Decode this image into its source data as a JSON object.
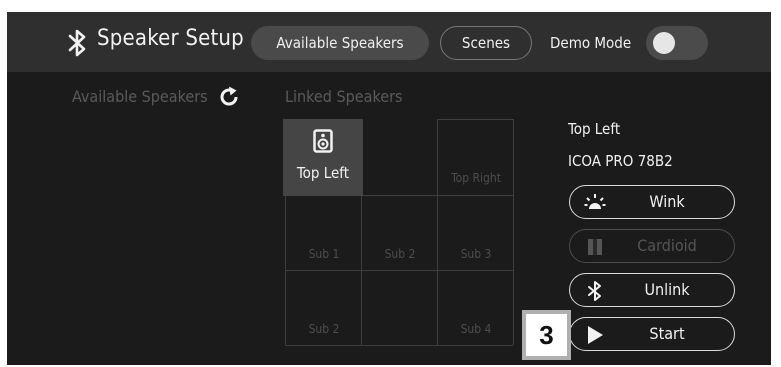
{
  "header": {
    "title": "Speaker Setup",
    "tabs": [
      {
        "label": "Available Speakers",
        "active": true
      },
      {
        "label": "Scenes",
        "active": false
      }
    ],
    "demo_mode": {
      "label": "Demo Mode",
      "enabled": false
    }
  },
  "panels": {
    "available_label": "Available Speakers",
    "linked_label": "Linked Speakers"
  },
  "grid": {
    "top_left": "Top Left",
    "top_right": "Top Right",
    "sub1": "Sub 1",
    "sub2_mid": "Sub 2",
    "sub3": "Sub 3",
    "sub2_bottom": "Sub 2",
    "sub4": "Sub 4"
  },
  "selected": {
    "name": "Top Left",
    "model": "ICOA PRO 78B2"
  },
  "actions": {
    "wink": "Wink",
    "cardioid": "Cardioid",
    "unlink": "Unlink",
    "start": "Start"
  },
  "callout": {
    "number": "3"
  },
  "colors": {
    "background": "#1b1b1b",
    "topbar": "#2f2f2f",
    "active_tab": "#4a4a4a",
    "selected_tile": "#454545",
    "disabled_text": "#555555"
  }
}
